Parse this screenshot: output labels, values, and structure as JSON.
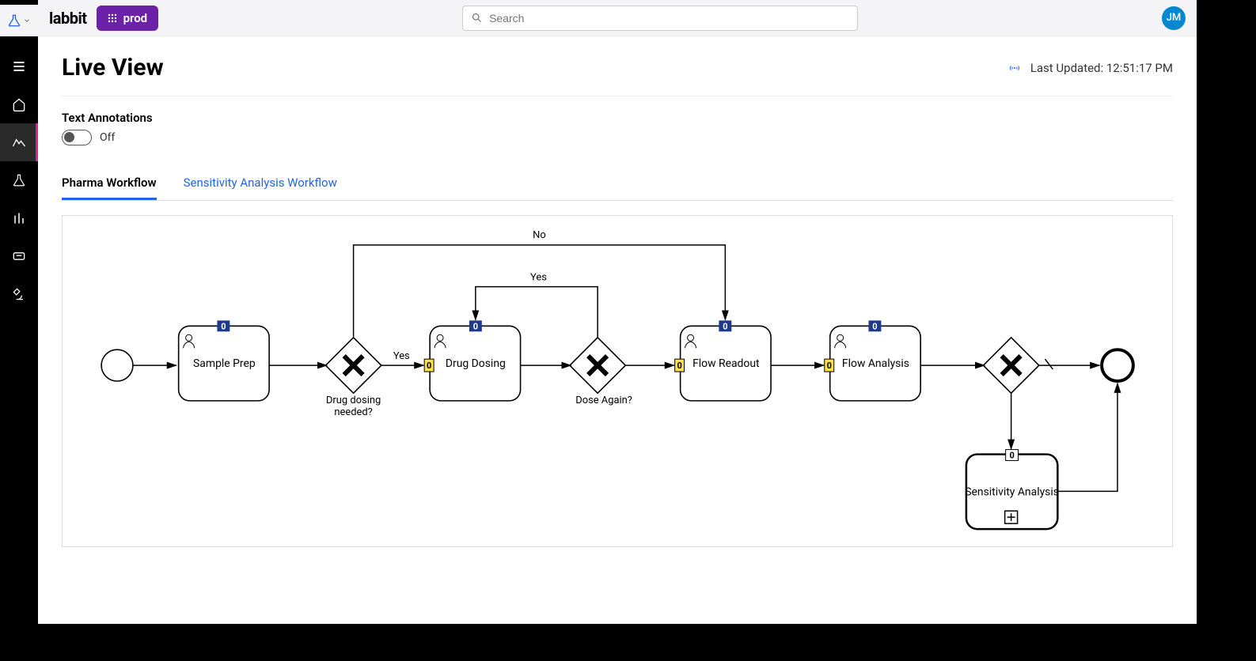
{
  "brand": "labbit",
  "env": "prod",
  "search": {
    "placeholder": "Search"
  },
  "avatar": "JM",
  "page": {
    "title": "Live View"
  },
  "updated": {
    "label": "Last Updated: 12:51:17 PM"
  },
  "annotations": {
    "section": "Text Annotations",
    "state": "Off"
  },
  "tabs": [
    {
      "label": "Pharma Workflow",
      "active": true
    },
    {
      "label": "Sensitivity Analysis Workflow",
      "active": false
    }
  ],
  "workflow": {
    "tasks": {
      "sample_prep": {
        "label": "Sample Prep",
        "badge": "0"
      },
      "drug_dosing": {
        "label": "Drug Dosing",
        "badge_top": "0",
        "badge_left": "0"
      },
      "flow_readout": {
        "label": "Flow Readout",
        "badge_top": "0",
        "badge_left": "0"
      },
      "flow_analysis": {
        "label": "Flow Analysis",
        "badge_top": "0",
        "badge_left": "0"
      },
      "sensitivity": {
        "label": "Sensitivity Analysis",
        "badge_top": "0"
      }
    },
    "gateways": {
      "gw1": {
        "label_l1": "Drug dosing",
        "label_l2": "needed?"
      },
      "gw2": {
        "label": "Dose Again?"
      }
    },
    "flows": {
      "yes": "Yes",
      "no": "No"
    }
  }
}
